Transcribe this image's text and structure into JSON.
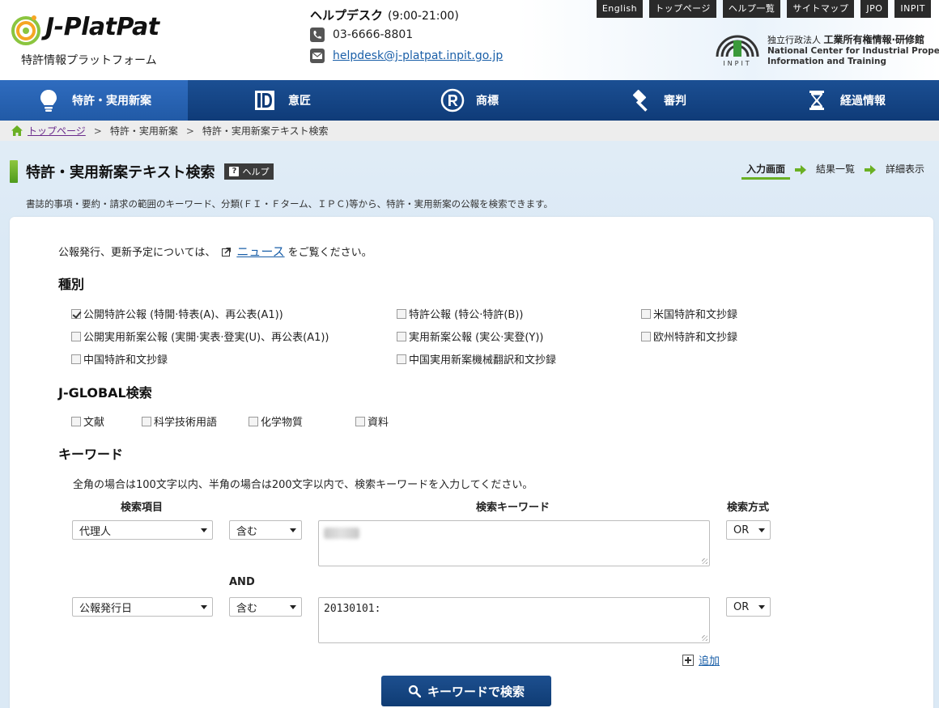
{
  "header": {
    "logo_text": "J-PlatPat",
    "logo_sub": "特許情報プラットフォーム",
    "helpdesk_title": "ヘルプデスク",
    "helpdesk_hours": "(9:00-21:00)",
    "phone": "03-6666-8801",
    "email": "helpdesk@j-platpat.inpit.go.jp",
    "top_links": [
      "English",
      "トップページ",
      "ヘルプ一覧",
      "サイトマップ",
      "JPO",
      "INPIT"
    ],
    "inpit_line1_prefix": "独立行政法人 ",
    "inpit_line1_name": "工業所有権情報·研修館",
    "inpit_line2": "National Center for Industrial Property",
    "inpit_line3": "Information and Training",
    "inpit_mark_text": "INPIT"
  },
  "nav": {
    "items": [
      {
        "label": "特許・実用新案",
        "icon": "lightbulb-icon"
      },
      {
        "label": "意匠",
        "icon": "design-d-icon"
      },
      {
        "label": "商標",
        "icon": "registered-r-icon"
      },
      {
        "label": "審判",
        "icon": "gavel-icon"
      },
      {
        "label": "経過情報",
        "icon": "hourglass-icon"
      }
    ]
  },
  "breadcrumb": {
    "items": [
      "トップページ",
      "特許・実用新案",
      "特許・実用新案テキスト検索"
    ]
  },
  "page": {
    "title": "特許・実用新案テキスト検索",
    "help_label": "ヘルプ",
    "help_glyph": "?",
    "steps": [
      "入力画面",
      "結果一覧",
      "詳細表示"
    ],
    "description": "書誌的事項・要約・請求の範囲のキーワード、分類(ＦＩ・Ｆターム、ＩＰＣ)等から、特許・実用新案の公報を検索できます。"
  },
  "notice": {
    "prefix": "公報発行、更新予定については、",
    "link": "ニュース",
    "suffix": "をご覧ください。"
  },
  "types": {
    "title": "種別",
    "options": [
      {
        "label": "公開特許公報 (特開·特表(A)、再公表(A1))",
        "checked": true
      },
      {
        "label": "特許公報 (特公·特許(B))",
        "checked": false
      },
      {
        "label": "米国特許和文抄録",
        "checked": false
      },
      {
        "label": "公開実用新案公報 (実開·実表·登実(U)、再公表(A1))",
        "checked": false
      },
      {
        "label": "実用新案公報 (実公·実登(Y))",
        "checked": false
      },
      {
        "label": "欧州特許和文抄録",
        "checked": false
      },
      {
        "label": "中国特許和文抄録",
        "checked": false
      },
      {
        "label": "中国実用新案機械翻訳和文抄録",
        "checked": false
      }
    ]
  },
  "jglobal": {
    "title": "J-GLOBAL検索",
    "options": [
      {
        "label": "文献",
        "checked": false
      },
      {
        "label": "科学技術用語",
        "checked": false
      },
      {
        "label": "化学物質",
        "checked": false
      },
      {
        "label": "資料",
        "checked": false
      }
    ]
  },
  "keyword": {
    "title": "キーワード",
    "note": "全角の場合は100文字以内、半角の場合は200文字以内で、検索キーワードを入力してください。",
    "col_item": "検索項目",
    "col_keyword": "検索キーワード",
    "col_method": "検索方式",
    "and_label": "AND",
    "rows": [
      {
        "item": "代理人",
        "op": "含む",
        "value": "",
        "method": "OR"
      },
      {
        "item": "公報発行日",
        "op": "含む",
        "value": "20130101:",
        "method": "OR"
      }
    ],
    "add_label": "追加",
    "search_button": "キーワードで検索"
  }
}
